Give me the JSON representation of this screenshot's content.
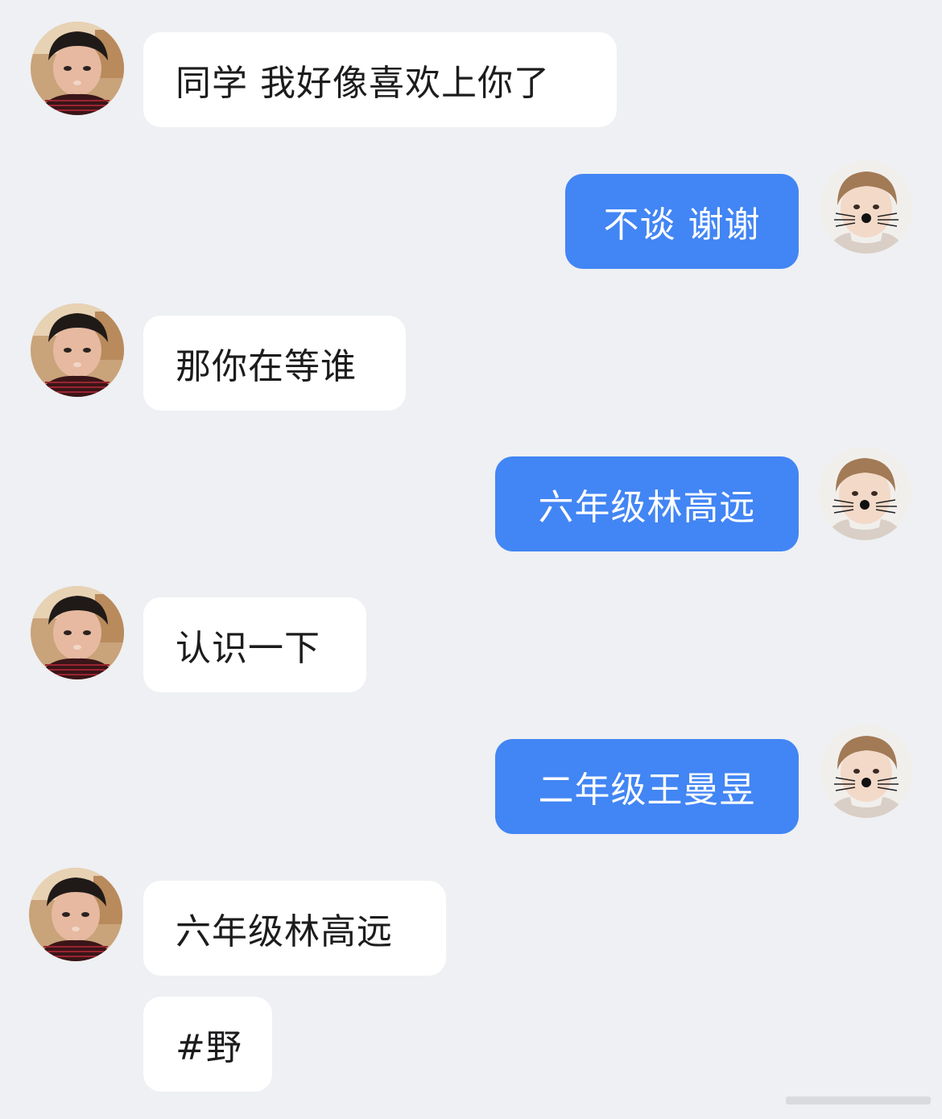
{
  "messages": [
    {
      "side": "left",
      "text": "同学 我好像喜欢上你了"
    },
    {
      "side": "right",
      "text": "不谈 谢谢"
    },
    {
      "side": "left",
      "text": "那你在等谁"
    },
    {
      "side": "right",
      "text": "六年级林高远"
    },
    {
      "side": "left",
      "text": "认识一下"
    },
    {
      "side": "right",
      "text": "二年级王曼昱"
    },
    {
      "side": "left",
      "text": "六年级林高远"
    },
    {
      "side": "left",
      "text": "#野"
    }
  ],
  "colors": {
    "background": "#eef0f3",
    "incoming_bubble": "#ffffff",
    "outgoing_bubble": "#4285f4",
    "incoming_text": "#1c1c1e",
    "outgoing_text": "#ffffff"
  },
  "avatars": {
    "left": "boy-portrait-avatar",
    "right": "cat-filter-portrait-avatar"
  }
}
